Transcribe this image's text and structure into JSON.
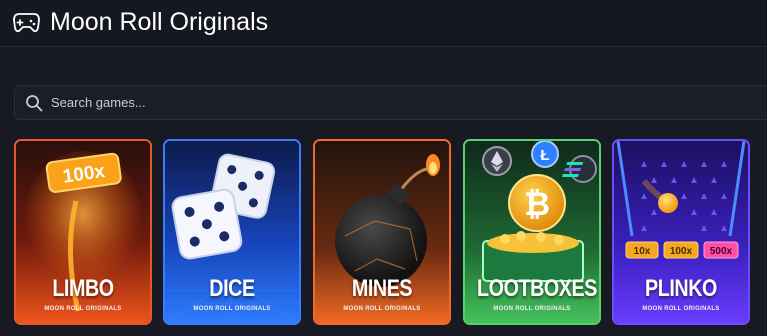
{
  "header": {
    "title": "Moon Roll Originals",
    "icon": "gamepad-icon"
  },
  "search": {
    "placeholder": "Search games...",
    "value": "",
    "icon": "search-icon"
  },
  "games": [
    {
      "title": "LIMBO",
      "subtitle": "MOON ROLL ORIGINALS",
      "badge": "100x",
      "border": "#e5582a"
    },
    {
      "title": "DICE",
      "subtitle": "MOON ROLL ORIGINALS",
      "border": "#3b7bff"
    },
    {
      "title": "MINES",
      "subtitle": "MOON ROLL ORIGINALS",
      "border": "#ef6a2c"
    },
    {
      "title": "LOOTBOXES",
      "subtitle": "MOON ROLL ORIGINALS",
      "border": "#56d46a"
    },
    {
      "title": "PLINKO",
      "subtitle": "MOON ROLL ORIGINALS",
      "multipliers": [
        "10x",
        "100x",
        "500x"
      ],
      "border": "#6d4cff"
    }
  ]
}
